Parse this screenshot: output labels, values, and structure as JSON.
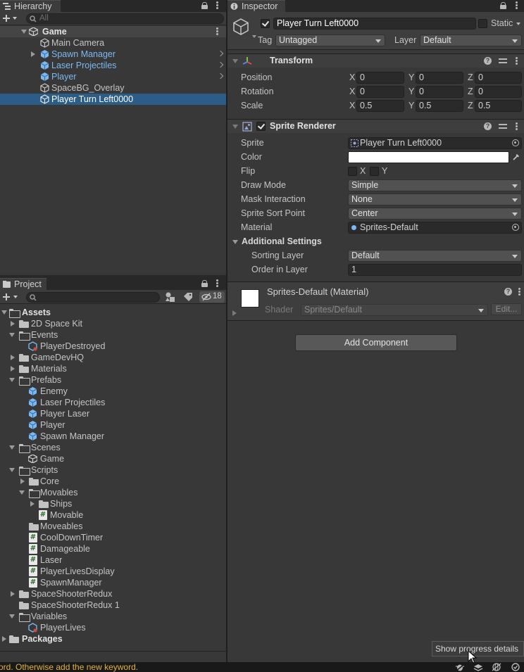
{
  "hierarchy": {
    "tab_label": "Hierarchy",
    "search_placeholder": "All",
    "items": [
      {
        "label": "Game",
        "indent": 0
      },
      {
        "label": "Main Camera",
        "indent": 1
      },
      {
        "label": "Spawn Manager",
        "indent": 1
      },
      {
        "label": "Laser Projectiles",
        "indent": 1
      },
      {
        "label": "Player",
        "indent": 1
      },
      {
        "label": "SpaceBG_Overlay",
        "indent": 1
      },
      {
        "label": "Player Turn Left0000",
        "indent": 1
      }
    ]
  },
  "project": {
    "tab_label": "Project",
    "hidden_count": "18",
    "items": [
      {
        "label": "Assets"
      },
      {
        "label": "2D Space Kit"
      },
      {
        "label": "Events"
      },
      {
        "label": "PlayerDestroyed"
      },
      {
        "label": "GameDevHQ"
      },
      {
        "label": "Materials"
      },
      {
        "label": "Prefabs"
      },
      {
        "label": "Enemy"
      },
      {
        "label": "Laser Projectiles"
      },
      {
        "label": "Player Laser"
      },
      {
        "label": "Player"
      },
      {
        "label": "Spawn Manager"
      },
      {
        "label": "Scenes"
      },
      {
        "label": "Game"
      },
      {
        "label": "Scripts"
      },
      {
        "label": "Core"
      },
      {
        "label": "Movables"
      },
      {
        "label": "Ships"
      },
      {
        "label": "Movable"
      },
      {
        "label": "Moveables"
      },
      {
        "label": "CoolDownTimer"
      },
      {
        "label": "Damageable"
      },
      {
        "label": "Laser"
      },
      {
        "label": "PlayerLivesDisplay"
      },
      {
        "label": "SpawnManager"
      },
      {
        "label": "SpaceShooterRedux"
      },
      {
        "label": "SpaceShooterRedux 1"
      },
      {
        "label": "Variables"
      },
      {
        "label": "PlayerLives"
      },
      {
        "label": "Packages"
      }
    ]
  },
  "inspector": {
    "tab_label": "Inspector",
    "object_name": "Player Turn Left0000",
    "static_label": "Static",
    "tag_label": "Tag",
    "tag_value": "Untagged",
    "layer_label": "Layer",
    "layer_value": "Default",
    "transform": {
      "title": "Transform",
      "position_label": "Position",
      "rotation_label": "Rotation",
      "scale_label": "Scale",
      "x": "X",
      "y": "Y",
      "z": "Z",
      "position": [
        "0",
        "0",
        "0"
      ],
      "rotation": [
        "0",
        "0",
        "0"
      ],
      "scale": [
        "0.5",
        "0.5",
        "0.5"
      ]
    },
    "sprite_renderer": {
      "title": "Sprite Renderer",
      "sprite_label": "Sprite",
      "sprite_value": "Player Turn Left0000",
      "color_label": "Color",
      "flip_label": "Flip",
      "flip_x": "X",
      "flip_y": "Y",
      "draw_mode_label": "Draw Mode",
      "draw_mode_value": "Simple",
      "mask_label": "Mask Interaction",
      "mask_value": "None",
      "sort_point_label": "Sprite Sort Point",
      "sort_point_value": "Center",
      "material_label": "Material",
      "material_value": "Sprites-Default",
      "additional_label": "Additional Settings",
      "sorting_layer_label": "Sorting Layer",
      "sorting_layer_value": "Default",
      "order_label": "Order in Layer",
      "order_value": "1"
    },
    "material": {
      "title": "Sprites-Default (Material)",
      "shader_label": "Shader",
      "shader_value": "Sprites/Default",
      "edit_label": "Edit..."
    },
    "add_component_label": "Add Component"
  },
  "status": {
    "console_message": "ord. Otherwise add the new keyword.",
    "tooltip": "Show progress details"
  },
  "colors": {
    "selection": "#2c5d87",
    "prefab_blue": "#7eb8f0",
    "warning_text": "#e0b33a"
  }
}
